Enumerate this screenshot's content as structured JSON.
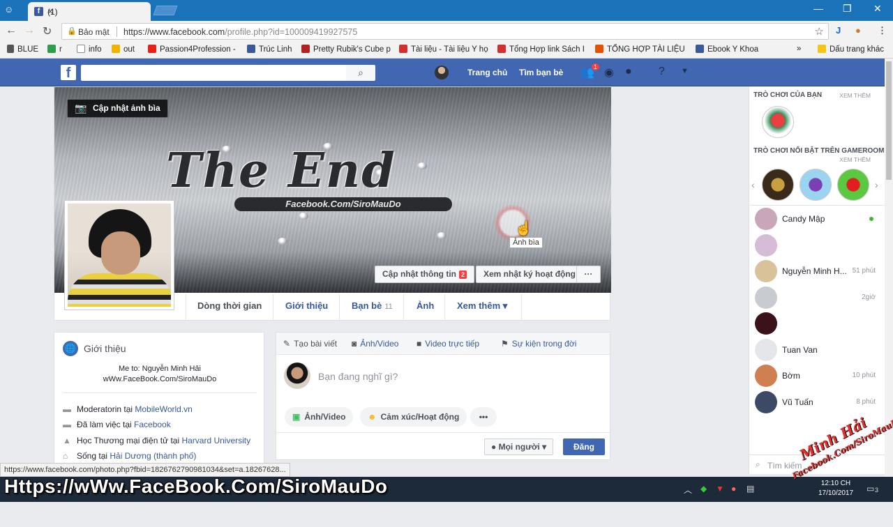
{
  "browser": {
    "tab_title": "(1)",
    "tab_close": "×",
    "window_controls": [
      "—",
      "❐",
      "✕"
    ],
    "security_label": "Bảo mật",
    "url_base": "https://www.facebook.com",
    "url_rest": "/profile.php?id=100009419927575"
  },
  "bookmarks": [
    {
      "label": "BLUE",
      "color": "#555555"
    },
    {
      "label": "r",
      "color": "#2e9e4a"
    },
    {
      "label": "info",
      "color": "#888888"
    },
    {
      "label": "out",
      "color": "#f0b400"
    },
    {
      "label": "Passion4Profession -",
      "color": "#e62117"
    },
    {
      "label": "Trúc Linh",
      "color": "#3b5998"
    },
    {
      "label": "Pretty Rubik's Cube p",
      "color": "#b22222"
    },
    {
      "label": "Tài liệu - Tài liệu Y họ",
      "color": "#d32f2f"
    },
    {
      "label": "Tổng Hợp link Sách I",
      "color": "#d32f2f"
    },
    {
      "label": "TỔNG HỢP TÀI LIỆU",
      "color": "#e65100"
    },
    {
      "label": "Ebook Y Khoa",
      "color": "#3b5998"
    },
    {
      "label": "»",
      "color": ""
    },
    {
      "label": "Dấu trang khác",
      "color": "#f5c518"
    }
  ],
  "fb_header": {
    "logo": "f",
    "search_placeholder": "",
    "nav_home": "Trang chủ",
    "nav_find_friends": "Tìm bạn bè",
    "friend_requests_badge": "1"
  },
  "cover": {
    "update_cover_label": "Cập nhật ảnh bìa",
    "cover_text": "The End",
    "cover_subtext": "Facebook.Com/SiroMauDo",
    "tooltip": "Ảnh bìa",
    "update_info_label": "Cập nhật thông tin",
    "update_info_count": "2",
    "activity_log_label": "Xem nhật ký hoạt động",
    "more_label": "···"
  },
  "profile_tabs": [
    {
      "label": "Dòng thời gian",
      "count": ""
    },
    {
      "label": "Giới thiệu",
      "count": ""
    },
    {
      "label": "Bạn bè",
      "count": "11"
    },
    {
      "label": "Ảnh",
      "count": ""
    },
    {
      "label": "Xem thêm ▾",
      "count": ""
    }
  ],
  "intro": {
    "title": "Giới thiệu",
    "bio_line1": "Me to: Nguyễn Minh Hải",
    "bio_line2": "wWw.FaceBook.Com/SiroMauDo",
    "rows": [
      {
        "prefix": "Moderatorin tại ",
        "link": "MobileWorld.vn",
        "icon": "briefcase"
      },
      {
        "prefix": "Đã làm việc tại ",
        "link": "Facebook",
        "icon": "briefcase"
      },
      {
        "prefix": "Học Thương mại điện tử tại ",
        "link": "Harvard University",
        "icon": "graduation-cap"
      },
      {
        "prefix": "Sống tại ",
        "link": "Hải Dương (thành phố)",
        "icon": "home"
      }
    ]
  },
  "composer": {
    "tabs": [
      "Tạo bài viết",
      "Ảnh/Video",
      "Video trực tiếp",
      "Sự kiện trong đời"
    ],
    "prompt": "Bạn đang nghĩ gì?",
    "photo_pill": "Ảnh/Video",
    "feeling_pill": "Cảm xúc/Hoạt động",
    "more_pill": "•••",
    "privacy": "Mọi người",
    "post": "Đăng"
  },
  "right_column": {
    "games_head": "TRÒ CHƠI CỦA BẠN",
    "games_see_more": "XEM THÊM",
    "featured_head": "TRÒ CHƠI NỔI BẬT TRÊN GAMEROOM",
    "featured_see_more": "XEM THÊM",
    "contacts": [
      {
        "name": "Candy Mập",
        "time": "",
        "online": true,
        "color": "#c9a7b8"
      },
      {
        "name": "",
        "time": "",
        "online": false,
        "color": "#d6bcd6"
      },
      {
        "name": "Nguyễn Minh H...",
        "time": "51 phút",
        "online": false,
        "color": "#d9c29a"
      },
      {
        "name": "",
        "time": "2giờ",
        "online": false,
        "color": "#c8ccd0"
      },
      {
        "name": "",
        "time": "",
        "online": false,
        "color": "#3a1218"
      },
      {
        "name": "Tuan Van",
        "time": "",
        "online": false,
        "color": "#e4e6ea"
      },
      {
        "name": "Bờm",
        "time": "10 phút",
        "online": false,
        "color": "#d08050"
      },
      {
        "name": "Vũ Tuấn",
        "time": "8 phút",
        "online": false,
        "color": "#3c4a66"
      }
    ],
    "search_placeholder": "Tìm kiếm"
  },
  "status_url": "https://www.facebook.com/photo.php?fbid=1826762790981034&set=a.18267628...",
  "taskbar": {
    "time": "12:10 CH",
    "date": "17/10/2017",
    "notification_count": "3"
  },
  "overlay_caption": "Https://wWw.FaceBook.Com/SiroMauDo",
  "watermark_line1": "Minh Hải",
  "watermark_line2": "Facebook.Com/SiroMauDo"
}
